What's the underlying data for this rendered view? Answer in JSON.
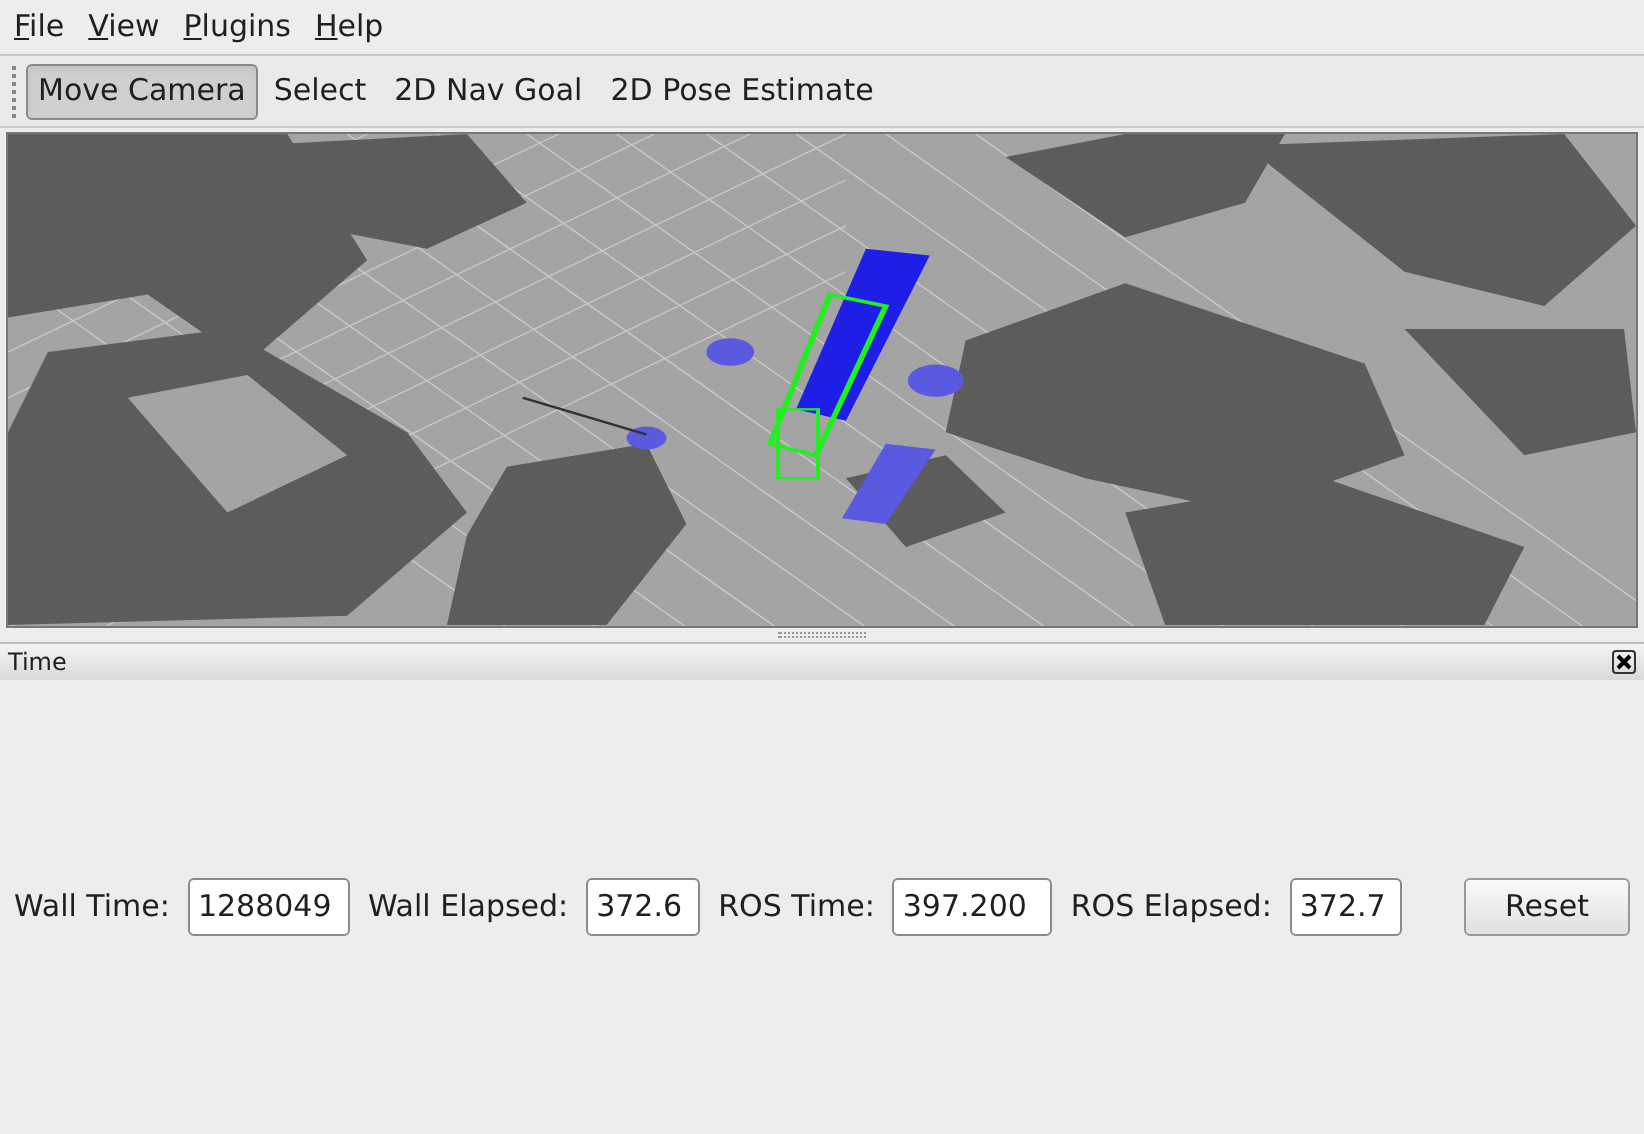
{
  "menu": [
    "File",
    "View",
    "Plugins",
    "Help"
  ],
  "tools": [
    {
      "label": "Move Camera",
      "selected": true
    },
    {
      "label": "Select",
      "selected": false
    },
    {
      "label": "2D Nav Goal",
      "selected": false
    },
    {
      "label": "2D Pose Estimate",
      "selected": false
    }
  ],
  "time_panel": {
    "title": "Time",
    "fields": [
      {
        "label": "Wall Time:",
        "value": "1288049"
      },
      {
        "label": "Wall Elapsed:",
        "value": "372.6"
      },
      {
        "label": "ROS Time:",
        "value": "397.200"
      },
      {
        "label": "ROS Elapsed:",
        "value": "372.7"
      }
    ],
    "button": "Reset"
  }
}
